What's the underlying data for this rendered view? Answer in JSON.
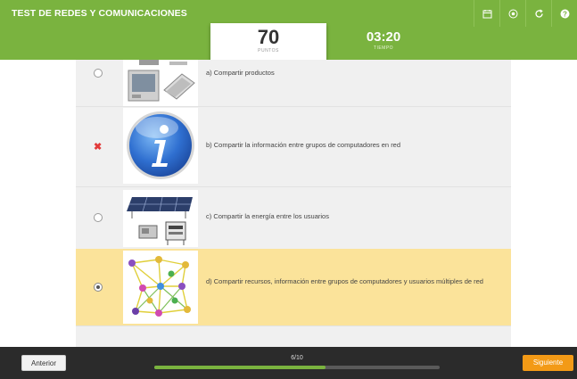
{
  "app": {
    "title": "TEST DE REDES Y COMUNICACIONES"
  },
  "toolbar": {
    "icons": [
      "calendar-icon",
      "eye-icon",
      "refresh-icon",
      "help-icon"
    ]
  },
  "score": {
    "value": "70",
    "label": "PUNTOS"
  },
  "timer": {
    "value": "03:20",
    "label": "TIEMPO"
  },
  "question": {
    "options": [
      {
        "letter": "a",
        "text": "a) Compartir productos",
        "state": "unselected",
        "image": "computer-hardware-image"
      },
      {
        "letter": "b",
        "text": "b) Compartir la información entre grupos de computadores en red",
        "state": "wrong",
        "image": "info-icon-image"
      },
      {
        "letter": "c",
        "text": "c) Compartir la energía entre los usuarios",
        "state": "unselected",
        "image": "solar-panels-image"
      },
      {
        "letter": "d",
        "text": "d) Compartir recursos, información entre grupos de computadores y usuarios múltiples de red",
        "state": "selected",
        "image": "network-diagram-image"
      }
    ]
  },
  "navigation": {
    "prev_label": "Anterior",
    "next_label": "Siguiente",
    "progress_text": "6/10",
    "progress_fraction": 0.6
  },
  "colors": {
    "brand_green": "#7ab33f",
    "selected_bg": "#fbe39a",
    "next_button": "#f39a16",
    "wrong_mark": "#e23a3a"
  }
}
